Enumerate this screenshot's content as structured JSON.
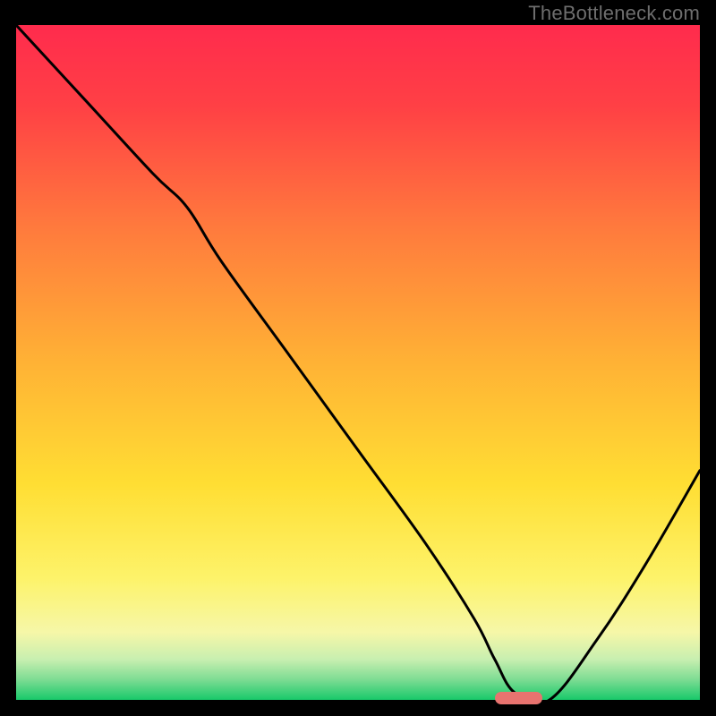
{
  "watermark": "TheBottleneck.com",
  "colors": {
    "gradient_top": "#ff2b4d",
    "gradient_mid1": "#ff8a3a",
    "gradient_mid2": "#ffd933",
    "gradient_mid3": "#faf88c",
    "gradient_bottom": "#18c96a",
    "curve": "#000000",
    "marker": "#e8736f",
    "frame": "#000000"
  },
  "chart_data": {
    "type": "line",
    "title": "",
    "xlabel": "",
    "ylabel": "",
    "xlim": [
      0,
      100
    ],
    "ylim": [
      0,
      100
    ],
    "x": [
      0,
      10,
      20,
      25,
      30,
      40,
      50,
      60,
      67,
      70,
      73,
      78,
      85,
      92,
      100
    ],
    "values": [
      100,
      89,
      78,
      73,
      65,
      51,
      37,
      23,
      12,
      6,
      1,
      0,
      9,
      20,
      34
    ],
    "marker": {
      "x_start": 70,
      "x_end": 77,
      "y": 0
    },
    "notes": "Values read from the plotted black curve against a 0–100 grid. Curve descends steeply from upper-left, reaches ~0 near x≈73–78 (green band at bottom), then rises toward the right. Background is a vertical red→orange→yellow→green gradient."
  }
}
